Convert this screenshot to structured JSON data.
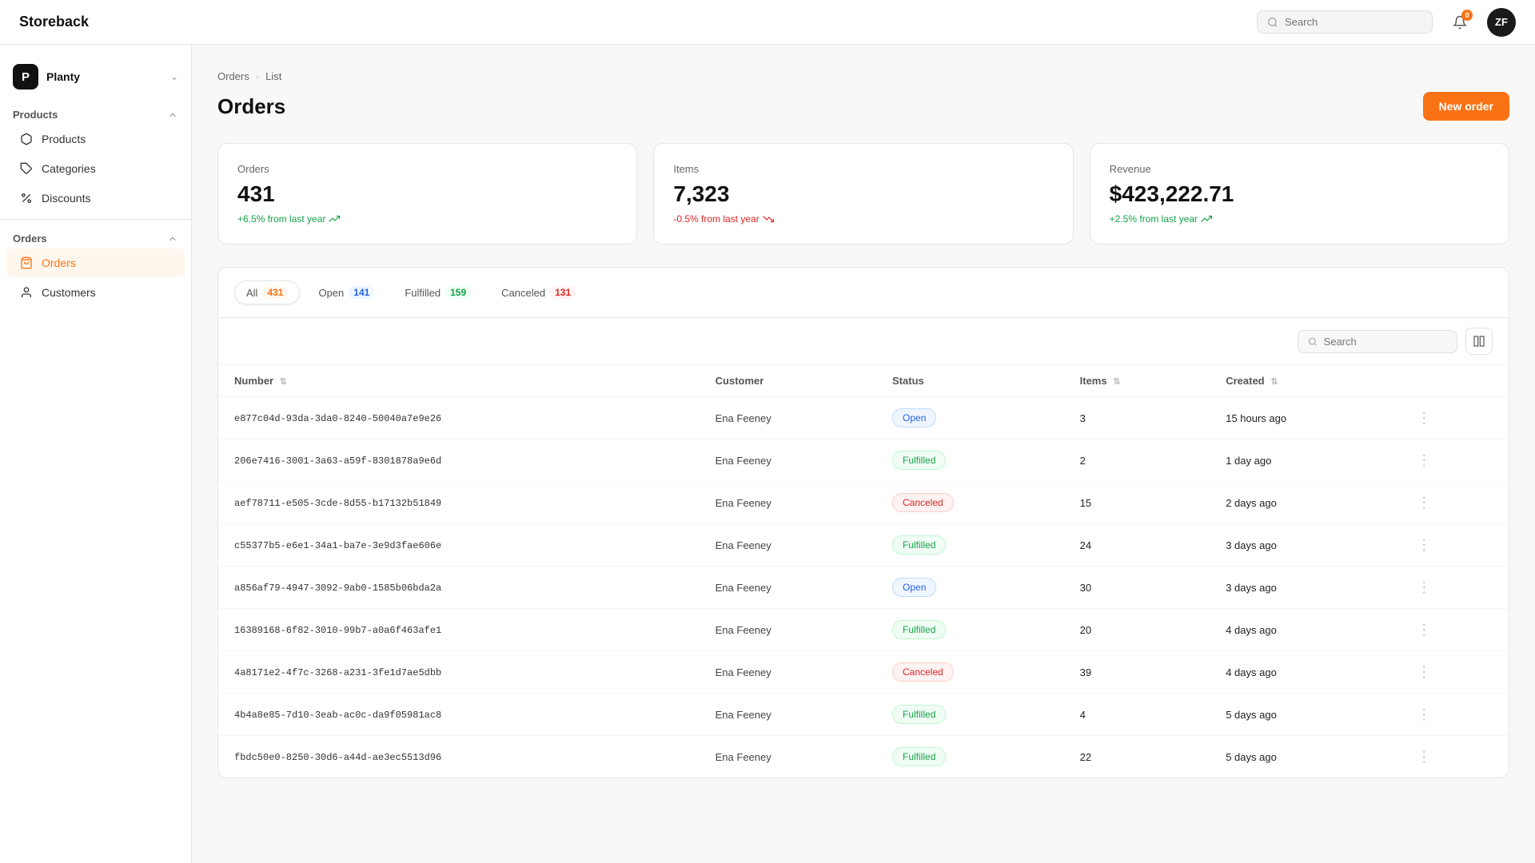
{
  "topbar": {
    "logo": "Storeback",
    "search_placeholder": "Search",
    "notification_count": "0",
    "avatar_initials": "ZF"
  },
  "sidebar": {
    "workspace": {
      "icon": "P",
      "name": "Planty"
    },
    "products_section": {
      "title": "Products",
      "items": [
        {
          "id": "products",
          "label": "Products",
          "icon": "box"
        },
        {
          "id": "categories",
          "label": "Categories",
          "icon": "tag"
        },
        {
          "id": "discounts",
          "label": "Discounts",
          "icon": "percent"
        }
      ]
    },
    "orders_section": {
      "title": "Orders",
      "items": [
        {
          "id": "orders",
          "label": "Orders",
          "icon": "shopping-bag",
          "active": true
        },
        {
          "id": "customers",
          "label": "Customers",
          "icon": "user"
        }
      ]
    }
  },
  "breadcrumb": {
    "parent": "Orders",
    "current": "List"
  },
  "page": {
    "title": "Orders",
    "new_order_label": "New order"
  },
  "stats": [
    {
      "id": "orders",
      "label": "Orders",
      "value": "431",
      "change": "+6.5% from last year",
      "trend": "positive"
    },
    {
      "id": "items",
      "label": "Items",
      "value": "7,323",
      "change": "-0.5% from last year",
      "trend": "negative"
    },
    {
      "id": "revenue",
      "label": "Revenue",
      "value": "$423,222.71",
      "change": "+2.5% from last year",
      "trend": "positive"
    }
  ],
  "filters": [
    {
      "id": "all",
      "label": "All",
      "count": "431",
      "count_type": "all",
      "active": true
    },
    {
      "id": "open",
      "label": "Open",
      "count": "141",
      "count_type": "open",
      "active": false
    },
    {
      "id": "fulfilled",
      "label": "Fulfilled",
      "count": "159",
      "count_type": "fulfilled",
      "active": false
    },
    {
      "id": "canceled",
      "label": "Canceled",
      "count": "131",
      "count_type": "canceled",
      "active": false
    }
  ],
  "table": {
    "search_placeholder": "Search",
    "columns": [
      {
        "id": "number",
        "label": "Number",
        "sortable": true
      },
      {
        "id": "customer",
        "label": "Customer",
        "sortable": false
      },
      {
        "id": "status",
        "label": "Status",
        "sortable": false
      },
      {
        "id": "items",
        "label": "Items",
        "sortable": true
      },
      {
        "id": "created",
        "label": "Created",
        "sortable": true
      }
    ],
    "rows": [
      {
        "id": "e877c04d-93da-3da0-8240-50040a7e9e26",
        "customer": "Ena Feeney",
        "status": "Open",
        "status_type": "open",
        "items": 3,
        "created": "15 hours ago"
      },
      {
        "id": "206e7416-3001-3a63-a59f-8301878a9e6d",
        "customer": "Ena Feeney",
        "status": "Fulfilled",
        "status_type": "fulfilled",
        "items": 2,
        "created": "1 day ago"
      },
      {
        "id": "aef78711-e505-3cde-8d55-b17132b51849",
        "customer": "Ena Feeney",
        "status": "Canceled",
        "status_type": "canceled",
        "items": 15,
        "created": "2 days ago"
      },
      {
        "id": "c55377b5-e6e1-34a1-ba7e-3e9d3fae606e",
        "customer": "Ena Feeney",
        "status": "Fulfilled",
        "status_type": "fulfilled",
        "items": 24,
        "created": "3 days ago"
      },
      {
        "id": "a856af79-4947-3092-9ab0-1585b06bda2a",
        "customer": "Ena Feeney",
        "status": "Open",
        "status_type": "open",
        "items": 30,
        "created": "3 days ago"
      },
      {
        "id": "16389168-6f82-3010-99b7-a0a6f463afe1",
        "customer": "Ena Feeney",
        "status": "Fulfilled",
        "status_type": "fulfilled",
        "items": 20,
        "created": "4 days ago"
      },
      {
        "id": "4a8171e2-4f7c-3268-a231-3fe1d7ae5dbb",
        "customer": "Ena Feeney",
        "status": "Canceled",
        "status_type": "canceled",
        "items": 39,
        "created": "4 days ago"
      },
      {
        "id": "4b4a8e85-7d10-3eab-ac0c-da9f05981ac8",
        "customer": "Ena Feeney",
        "status": "Fulfilled",
        "status_type": "fulfilled",
        "items": 4,
        "created": "5 days ago"
      },
      {
        "id": "fbdc50e0-8250-30d6-a44d-ae3ec5513d96",
        "customer": "Ena Feeney",
        "status": "Fulfilled",
        "status_type": "fulfilled",
        "items": 22,
        "created": "5 days ago"
      }
    ]
  }
}
